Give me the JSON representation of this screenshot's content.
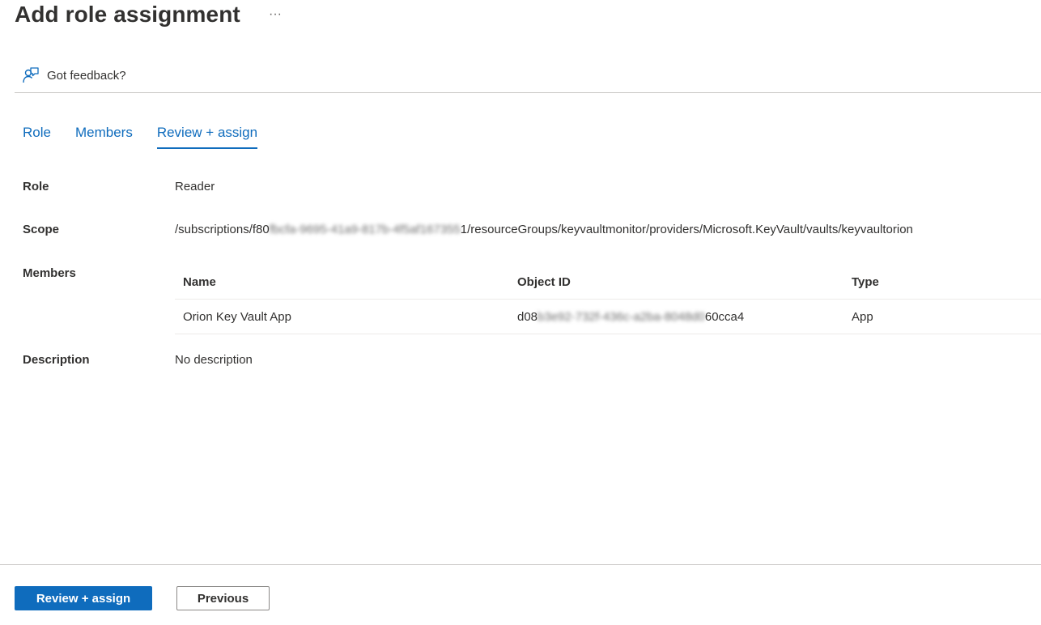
{
  "header": {
    "title": "Add role assignment",
    "more_label": "···"
  },
  "feedback": {
    "label": "Got feedback?",
    "icon": "feedback-icon"
  },
  "tabs": [
    {
      "label": "Role",
      "active": false
    },
    {
      "label": "Members",
      "active": false
    },
    {
      "label": "Review + assign",
      "active": true
    }
  ],
  "details": {
    "role": {
      "label": "Role",
      "value": "Reader"
    },
    "scope": {
      "label": "Scope",
      "prefix": "/subscriptions/f80",
      "redacted": "fbcfa-9695-41a9-817b-4f5af167355",
      "suffix": "1/resourceGroups/keyvaultmonitor/providers/Microsoft.KeyVault/vaults/keyvaultorion"
    },
    "members": {
      "label": "Members",
      "columns": {
        "name": "Name",
        "object_id": "Object ID",
        "type": "Type"
      },
      "rows": [
        {
          "name": "Orion Key Vault App",
          "object_id_prefix": "d08",
          "object_id_redacted": "b3e92-732f-436c-a2ba-8048d0",
          "object_id_suffix": "60cca4",
          "type": "App"
        }
      ]
    },
    "description": {
      "label": "Description",
      "value": "No description"
    }
  },
  "footer": {
    "primary_label": "Review + assign",
    "secondary_label": "Previous"
  },
  "colors": {
    "accent": "#0f6cbd",
    "divider": "#c8c6c4"
  }
}
